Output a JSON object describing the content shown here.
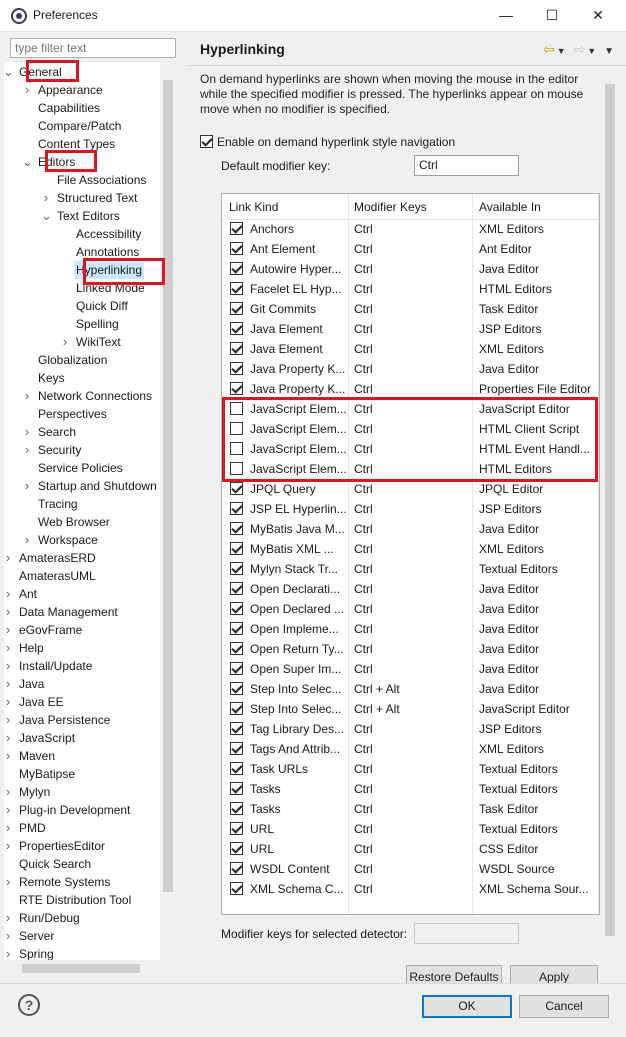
{
  "window": {
    "title": "Preferences",
    "minimize": "—",
    "maximize": "☐",
    "close": "✕"
  },
  "filter": {
    "placeholder": "type filter text"
  },
  "tree": [
    {
      "label": "General",
      "level": 0,
      "arrow": "down"
    },
    {
      "label": "Appearance",
      "level": 1,
      "arrow": "right"
    },
    {
      "label": "Capabilities",
      "level": 1,
      "arrow": ""
    },
    {
      "label": "Compare/Patch",
      "level": 1,
      "arrow": ""
    },
    {
      "label": "Content Types",
      "level": 1,
      "arrow": ""
    },
    {
      "label": "Editors",
      "level": 1,
      "arrow": "down"
    },
    {
      "label": "File Associations",
      "level": 2,
      "arrow": ""
    },
    {
      "label": "Structured Text",
      "level": 2,
      "arrow": "right"
    },
    {
      "label": "Text Editors",
      "level": 2,
      "arrow": "down"
    },
    {
      "label": "Accessibility",
      "level": 3,
      "arrow": ""
    },
    {
      "label": "Annotations",
      "level": 3,
      "arrow": ""
    },
    {
      "label": "Hyperlinking",
      "level": 3,
      "arrow": "",
      "selected": true
    },
    {
      "label": "Linked Mode",
      "level": 3,
      "arrow": ""
    },
    {
      "label": "Quick Diff",
      "level": 3,
      "arrow": ""
    },
    {
      "label": "Spelling",
      "level": 3,
      "arrow": ""
    },
    {
      "label": "WikiText",
      "level": 3,
      "arrow": "right"
    },
    {
      "label": "Globalization",
      "level": 1,
      "arrow": ""
    },
    {
      "label": "Keys",
      "level": 1,
      "arrow": ""
    },
    {
      "label": "Network Connections",
      "level": 1,
      "arrow": "right"
    },
    {
      "label": "Perspectives",
      "level": 1,
      "arrow": ""
    },
    {
      "label": "Search",
      "level": 1,
      "arrow": "right"
    },
    {
      "label": "Security",
      "level": 1,
      "arrow": "right"
    },
    {
      "label": "Service Policies",
      "level": 1,
      "arrow": ""
    },
    {
      "label": "Startup and Shutdown",
      "level": 1,
      "arrow": "right"
    },
    {
      "label": "Tracing",
      "level": 1,
      "arrow": ""
    },
    {
      "label": "Web Browser",
      "level": 1,
      "arrow": ""
    },
    {
      "label": "Workspace",
      "level": 1,
      "arrow": "right"
    },
    {
      "label": "AmaterasERD",
      "level": 0,
      "arrow": "right"
    },
    {
      "label": "AmaterasUML",
      "level": 0,
      "arrow": ""
    },
    {
      "label": "Ant",
      "level": 0,
      "arrow": "right"
    },
    {
      "label": "Data Management",
      "level": 0,
      "arrow": "right"
    },
    {
      "label": "eGovFrame",
      "level": 0,
      "arrow": "right"
    },
    {
      "label": "Help",
      "level": 0,
      "arrow": "right"
    },
    {
      "label": "Install/Update",
      "level": 0,
      "arrow": "right"
    },
    {
      "label": "Java",
      "level": 0,
      "arrow": "right"
    },
    {
      "label": "Java EE",
      "level": 0,
      "arrow": "right"
    },
    {
      "label": "Java Persistence",
      "level": 0,
      "arrow": "right"
    },
    {
      "label": "JavaScript",
      "level": 0,
      "arrow": "right"
    },
    {
      "label": "Maven",
      "level": 0,
      "arrow": "right"
    },
    {
      "label": "MyBatipse",
      "level": 0,
      "arrow": ""
    },
    {
      "label": "Mylyn",
      "level": 0,
      "arrow": "right"
    },
    {
      "label": "Plug-in Development",
      "level": 0,
      "arrow": "right"
    },
    {
      "label": "PMD",
      "level": 0,
      "arrow": "right"
    },
    {
      "label": "PropertiesEditor",
      "level": 0,
      "arrow": "right"
    },
    {
      "label": "Quick Search",
      "level": 0,
      "arrow": ""
    },
    {
      "label": "Remote Systems",
      "level": 0,
      "arrow": "right"
    },
    {
      "label": "RTE Distribution Tool",
      "level": 0,
      "arrow": ""
    },
    {
      "label": "Run/Debug",
      "level": 0,
      "arrow": "right"
    },
    {
      "label": "Server",
      "level": 0,
      "arrow": "right"
    },
    {
      "label": "Spring",
      "level": 0,
      "arrow": "right"
    }
  ],
  "page": {
    "title": "Hyperlinking",
    "description": "On demand hyperlinks are shown when moving the mouse in the editor while the specified modifier is pressed. The hyperlinks appear on mouse move when no modifier is specified.",
    "enable_label": "Enable on demand hyperlink style navigation",
    "enable_checked": true,
    "modifier_label": "Default modifier key:",
    "modifier_value": "Ctrl",
    "detector_label": "Modifier keys for selected detector:",
    "restore_defaults_label": "Restore Defaults",
    "apply_label": "Apply"
  },
  "table": {
    "headers": [
      "Link Kind",
      "Modifier Keys",
      "Available In"
    ],
    "rows": [
      {
        "checked": true,
        "kind": "Anchors",
        "mod": "Ctrl",
        "avail": "XML Editors"
      },
      {
        "checked": true,
        "kind": "Ant Element",
        "mod": "Ctrl",
        "avail": "Ant Editor"
      },
      {
        "checked": true,
        "kind": "Autowire Hyper...",
        "mod": "Ctrl",
        "avail": "Java Editor"
      },
      {
        "checked": true,
        "kind": "Facelet EL Hyp...",
        "mod": "Ctrl",
        "avail": "HTML Editors"
      },
      {
        "checked": true,
        "kind": "Git Commits",
        "mod": "Ctrl",
        "avail": "Task Editor"
      },
      {
        "checked": true,
        "kind": "Java Element",
        "mod": "Ctrl",
        "avail": "JSP Editors"
      },
      {
        "checked": true,
        "kind": "Java Element",
        "mod": "Ctrl",
        "avail": "XML Editors"
      },
      {
        "checked": true,
        "kind": "Java Property K...",
        "mod": "Ctrl",
        "avail": "Java Editor"
      },
      {
        "checked": true,
        "kind": "Java Property K...",
        "mod": "Ctrl",
        "avail": "Properties File Editor"
      },
      {
        "checked": false,
        "kind": "JavaScript Elem...",
        "mod": "Ctrl",
        "avail": "JavaScript Editor"
      },
      {
        "checked": false,
        "kind": "JavaScript Elem...",
        "mod": "Ctrl",
        "avail": "HTML Client Script"
      },
      {
        "checked": false,
        "kind": "JavaScript Elem...",
        "mod": "Ctrl",
        "avail": "HTML Event Handl..."
      },
      {
        "checked": false,
        "kind": "JavaScript Elem...",
        "mod": "Ctrl",
        "avail": "HTML Editors"
      },
      {
        "checked": true,
        "kind": "JPQL Query",
        "mod": "Ctrl",
        "avail": "JPQL Editor"
      },
      {
        "checked": true,
        "kind": "JSP EL Hyperlin...",
        "mod": "Ctrl",
        "avail": "JSP Editors"
      },
      {
        "checked": true,
        "kind": "MyBatis Java M...",
        "mod": "Ctrl",
        "avail": "Java Editor"
      },
      {
        "checked": true,
        "kind": "MyBatis XML ...",
        "mod": "Ctrl",
        "avail": "XML Editors"
      },
      {
        "checked": true,
        "kind": "Mylyn Stack Tr...",
        "mod": "Ctrl",
        "avail": "Textual Editors"
      },
      {
        "checked": true,
        "kind": "Open Declarati...",
        "mod": "Ctrl",
        "avail": "Java Editor"
      },
      {
        "checked": true,
        "kind": "Open Declared ...",
        "mod": "Ctrl",
        "avail": "Java Editor"
      },
      {
        "checked": true,
        "kind": "Open Impleme...",
        "mod": "Ctrl",
        "avail": "Java Editor"
      },
      {
        "checked": true,
        "kind": "Open Return Ty...",
        "mod": "Ctrl",
        "avail": "Java Editor"
      },
      {
        "checked": true,
        "kind": "Open Super Im...",
        "mod": "Ctrl",
        "avail": "Java Editor"
      },
      {
        "checked": true,
        "kind": "Step Into Selec...",
        "mod": "Ctrl + Alt",
        "avail": "Java Editor"
      },
      {
        "checked": true,
        "kind": "Step Into Selec...",
        "mod": "Ctrl + Alt",
        "avail": "JavaScript Editor"
      },
      {
        "checked": true,
        "kind": "Tag Library Des...",
        "mod": "Ctrl",
        "avail": "JSP Editors"
      },
      {
        "checked": true,
        "kind": "Tags And Attrib...",
        "mod": "Ctrl",
        "avail": "XML Editors"
      },
      {
        "checked": true,
        "kind": "Task URLs",
        "mod": "Ctrl",
        "avail": "Textual Editors"
      },
      {
        "checked": true,
        "kind": "Tasks",
        "mod": "Ctrl",
        "avail": "Textual Editors"
      },
      {
        "checked": true,
        "kind": "Tasks",
        "mod": "Ctrl",
        "avail": "Task Editor"
      },
      {
        "checked": true,
        "kind": "URL",
        "mod": "Ctrl",
        "avail": "Textual Editors"
      },
      {
        "checked": true,
        "kind": "URL",
        "mod": "Ctrl",
        "avail": "CSS Editor"
      },
      {
        "checked": true,
        "kind": "WSDL Content",
        "mod": "Ctrl",
        "avail": "WSDL Source"
      },
      {
        "checked": true,
        "kind": "XML Schema C...",
        "mod": "Ctrl",
        "avail": "XML Schema Sour..."
      }
    ]
  },
  "buttons": {
    "ok": "OK",
    "cancel": "Cancel",
    "help": "?"
  },
  "colors": {
    "highlight": "#e0141e",
    "selection": "#cce8ff",
    "accent": "#0078d7"
  }
}
